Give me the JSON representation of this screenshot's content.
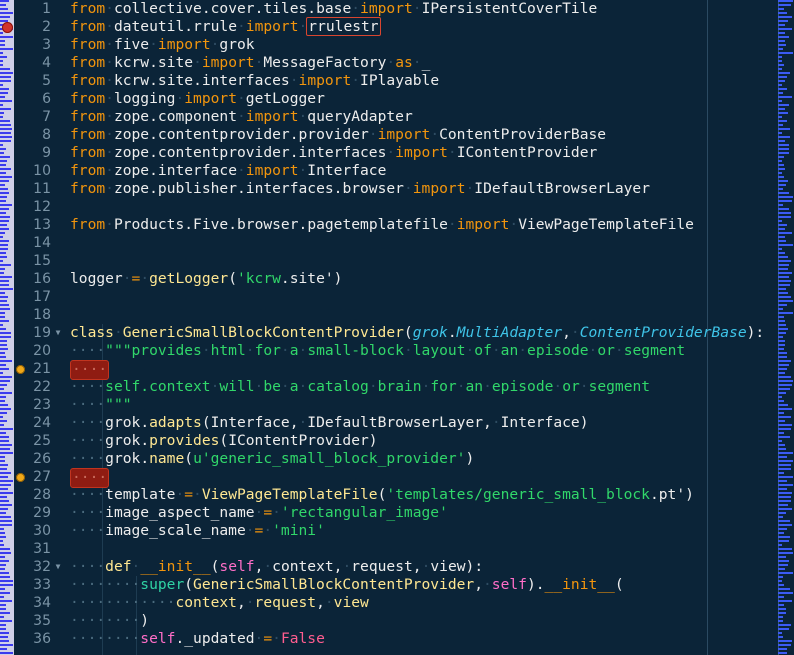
{
  "editor": {
    "name": "code-editor",
    "language": "python",
    "first_line": 1,
    "last_line": 36,
    "line_height": 18,
    "colors": {
      "background": "#0B2438",
      "gutter_text": "#7B94A6",
      "keyword": "#F2950D",
      "definition": "#FFE792",
      "string": "#31D76A",
      "identifier": "#EDEDED",
      "class_italic": "#3FC4E8",
      "self": "#FF6EC7",
      "builtin": "#2FD3A4",
      "boolean": "#FF5D8F",
      "whitespace_dot": "#2E4C62",
      "error_box_border": "#D9452F",
      "trailing_whitespace_bg": "#8F1C12",
      "breakpoint": "#D0342C",
      "warning_marker": "#F0A818",
      "minimap_tick": "#3B5BF5",
      "left_strip_bg": "#CFCFE8",
      "margin_rule": "#2B4A62",
      "indent_guide": "#1E3C52"
    },
    "markers": {
      "breakpoint_lines": [
        2
      ],
      "warning_lines": [
        21,
        27
      ],
      "fold_lines": [
        19,
        32
      ],
      "fold_glyph": "▼",
      "error_token": "rrulestr",
      "error_token_line": 2,
      "trailing_whitespace_lines": [
        21,
        27
      ]
    },
    "gutter_line_numbers": [
      "1",
      "2",
      "3",
      "4",
      "5",
      "6",
      "7",
      "8",
      "9",
      "10",
      "11",
      "12",
      "13",
      "14",
      "15",
      "16",
      "17",
      "18",
      "19",
      "20",
      "21",
      "22",
      "23",
      "24",
      "25",
      "26",
      "27",
      "28",
      "29",
      "30",
      "31",
      "32",
      "33",
      "34",
      "35",
      "36"
    ],
    "lines": [
      {
        "n": 1,
        "text": "from collective.cover.tiles.base import IPersistentCoverTile"
      },
      {
        "n": 2,
        "text": "from dateutil.rrule import rrulestr"
      },
      {
        "n": 3,
        "text": "from five import grok"
      },
      {
        "n": 4,
        "text": "from kcrw.site import MessageFactory as _"
      },
      {
        "n": 5,
        "text": "from kcrw.site.interfaces import IPlayable"
      },
      {
        "n": 6,
        "text": "from logging import getLogger"
      },
      {
        "n": 7,
        "text": "from zope.component import queryAdapter"
      },
      {
        "n": 8,
        "text": "from zope.contentprovider.provider import ContentProviderBase"
      },
      {
        "n": 9,
        "text": "from zope.contentprovider.interfaces import IContentProvider"
      },
      {
        "n": 10,
        "text": "from zope.interface import Interface"
      },
      {
        "n": 11,
        "text": "from zope.publisher.interfaces.browser import IDefaultBrowserLayer"
      },
      {
        "n": 12,
        "text": ""
      },
      {
        "n": 13,
        "text": "from Products.Five.browser.pagetemplatefile import ViewPageTemplateFile"
      },
      {
        "n": 14,
        "text": ""
      },
      {
        "n": 15,
        "text": ""
      },
      {
        "n": 16,
        "text": "logger = getLogger('kcrw.site')"
      },
      {
        "n": 17,
        "text": ""
      },
      {
        "n": 18,
        "text": ""
      },
      {
        "n": 19,
        "text": "class GenericSmallBlockContentProvider(grok.MultiAdapter, ContentProviderBase):"
      },
      {
        "n": 20,
        "text": "    \"\"\"provides html for a small-block layout of an episode or segment"
      },
      {
        "n": 21,
        "text": "    "
      },
      {
        "n": 22,
        "text": "    self.context will be a catalog brain for an episode or segment"
      },
      {
        "n": 23,
        "text": "    \"\"\""
      },
      {
        "n": 24,
        "text": "    grok.adapts(Interface, IDefaultBrowserLayer, Interface)"
      },
      {
        "n": 25,
        "text": "    grok.provides(IContentProvider)"
      },
      {
        "n": 26,
        "text": "    grok.name(u'generic_small_block_provider')"
      },
      {
        "n": 27,
        "text": "    "
      },
      {
        "n": 28,
        "text": "    template = ViewPageTemplateFile('templates/generic_small_block.pt')"
      },
      {
        "n": 29,
        "text": "    image_aspect_name = 'rectangular_image'"
      },
      {
        "n": 30,
        "text": "    image_scale_name = 'mini'"
      },
      {
        "n": 31,
        "text": ""
      },
      {
        "n": 32,
        "text": "    def __init__(self, context, request, view):"
      },
      {
        "n": 33,
        "text": "        super(GenericSmallBlockContentProvider, self).__init__("
      },
      {
        "n": 34,
        "text": "            context, request, view"
      },
      {
        "n": 35,
        "text": "        )"
      },
      {
        "n": 36,
        "text": "        self._updated = False"
      }
    ]
  }
}
